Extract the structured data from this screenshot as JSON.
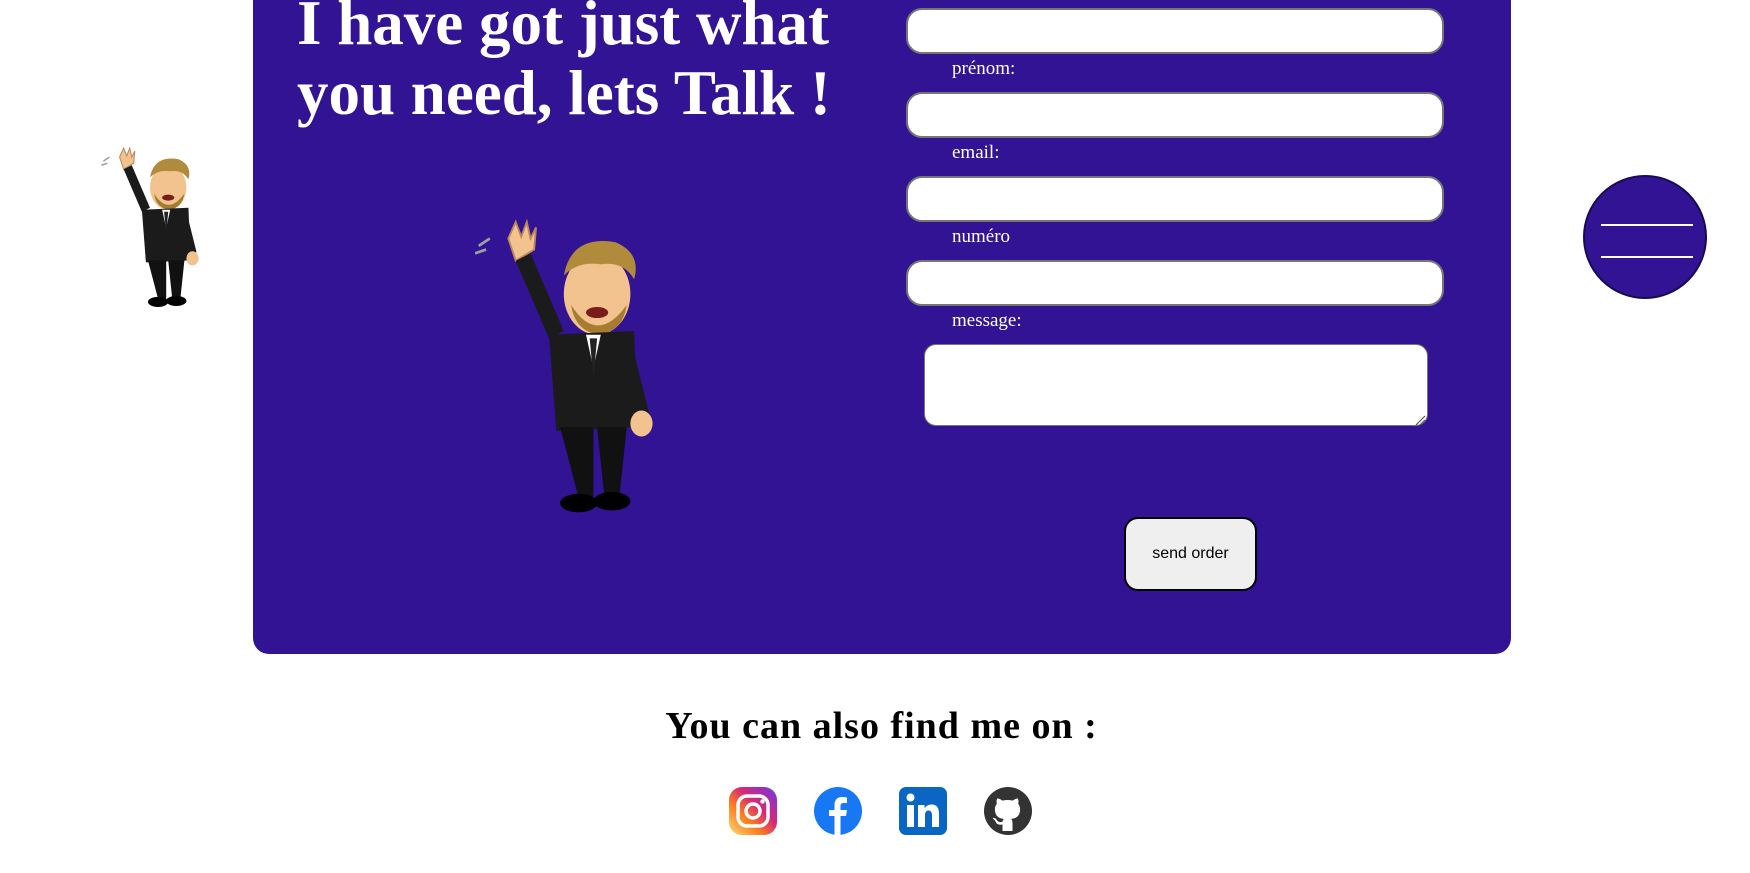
{
  "contact": {
    "headline": "I have got just what you need, lets Talk !",
    "fields": {
      "nom_value": "",
      "prenom_label": "prénom:",
      "prenom_value": "",
      "email_label": "email:",
      "email_value": "",
      "numero_label": "numéro",
      "numero_value": "",
      "message_label": "message:",
      "message_value": ""
    },
    "submit_label": "send order"
  },
  "footer": {
    "title": "You can also find me on :",
    "socials": [
      {
        "icon": "instagram-icon"
      },
      {
        "icon": "facebook-icon"
      },
      {
        "icon": "linkedin-icon"
      },
      {
        "icon": "github-icon"
      }
    ]
  },
  "colors": {
    "panel": "#311394",
    "text_on_panel": "#ffffff",
    "facebook": "#1877f2",
    "linkedin": "#0a66c2",
    "github": "#333333"
  }
}
